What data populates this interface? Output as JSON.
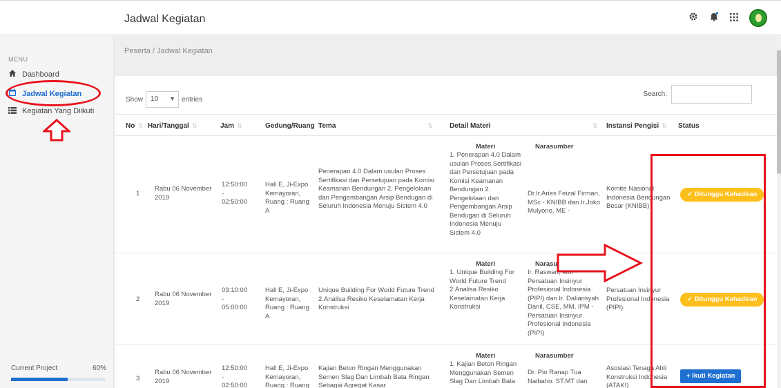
{
  "header": {
    "title": "Jadwal Kegiatan",
    "icons": [
      "gear-icon",
      "bell-icon",
      "apps-grid-icon"
    ],
    "avatar": "user-avatar"
  },
  "sidebar": {
    "menu_label": "MENU",
    "items": [
      {
        "label": "Dashboard",
        "icon": "home-icon"
      },
      {
        "label": "Jadwal Kegiatan",
        "icon": "calendar-icon",
        "active": true
      },
      {
        "label": "Kegiatan Yang Diikuti",
        "icon": "list-icon"
      }
    ],
    "project": {
      "label": "Current Project",
      "percent_text": "60%",
      "percent": 60
    }
  },
  "breadcrumb": "Peserta / Jadwal Kegiatan",
  "table_controls": {
    "show_label": "Show",
    "entries_value": "10",
    "entries_label": "entries",
    "search_label": "Search:",
    "search_value": ""
  },
  "table": {
    "columns": [
      "No",
      "Hari/Tanggal",
      "Jam",
      "Gedung/Ruang",
      "Tema",
      "Detail Materi",
      "Instansi Pengisi",
      "Status"
    ],
    "detail_headers": {
      "materi": "Materi",
      "narasumber": "Narasumber"
    },
    "rows": [
      {
        "no": "1",
        "tanggal": "Rabu 06 November 2019",
        "jam_mulai": "12:50:00",
        "jam_sep": "-",
        "jam_selesai": "02:50:00",
        "gedung": "Hall E, Ji-Expo Kemayoran, Ruang : Ruang A",
        "tema": "Penerapan 4.0 Dalam usulan Proses Sertifikasi dan Persetujuan pada Komisi Keamanan Bendungan 2. Pengelolaan dan Pengembangan Arsip Bendugan di Seluruh Indonesia Menuju Sistem 4.0",
        "materi": "1. Penerapan 4.0 Dalam usulan Proses Sertifikasi dan Persetujuan pada Komisi Keamanan Bendungan 2. Pengelolaan dan Pengembangan Arsip Bendugan di Seluruh Indonesia Menuju Sistem 4.0",
        "narasumber": "Dr.Ir.Aries Feizal Firman, MSc - KNIBB dan Ir.Joko Mulyono, ME -",
        "instansi": "Komite Nasional Indonesia Bendungan Besar (KNIBB)",
        "status": "✓ Ditunggu Kehadiran"
      },
      {
        "no": "2",
        "tanggal": "Rabu 06 November 2019",
        "jam_mulai": "03:10:00",
        "jam_sep": "-",
        "jam_selesai": "05:00:00",
        "gedung": "Hall E, Ji-Expo Kemayoran, Ruang : Ruang A",
        "tema": "Unique Building For World Future Trend 2.Analisa Resiko Keselamatan Kerja Konstruksi",
        "materi": "1. Unique Building For World Future Trend 2.Analisa Resiko Keselamatan Kerja Konstruksi",
        "narasumber": "Ir. Raswari, MM - Persatuan Insinyur Profesional Indonesia (PIPI) dan Ir. Daliansyah Danil, CSE, MM, IPM - Persatuan Insinyur Profesional Indonesia (PIPI)",
        "instansi": "Persatuan Insinyur Profesional Indonesia (PIPI)",
        "status": "✓ Ditunggu Kehadiran"
      },
      {
        "no": "3",
        "tanggal": "Rabu 06 November 2019",
        "jam_mulai": "12:50:00",
        "jam_sep": "-",
        "jam_selesai": "02:50:00",
        "gedung": "Hall E, Ji-Expo Kemayoran, Ruang : Ruang B",
        "tema": "Kajian Beton Ringan Menggunakan Semen Slag Dan Limbah Bata Ringan Sebagai Agregat Kasar",
        "materi": "1. Kajian Beton Ringan Menggunakan Semen Slag Dan Limbah Bata",
        "narasumber": "Dr. Pio Ranap Tua Naibaho. ST.MT dan",
        "instansi": "Asosiasi Tenaga Ahli Konstruksi Indonesia (ATAKI)",
        "status": "+ Ikuti Kegiatan"
      }
    ]
  },
  "annotation_colors": {
    "highlight": "#e8121c",
    "accent": "#1e6fcf",
    "badge": "#fcbf1b"
  }
}
